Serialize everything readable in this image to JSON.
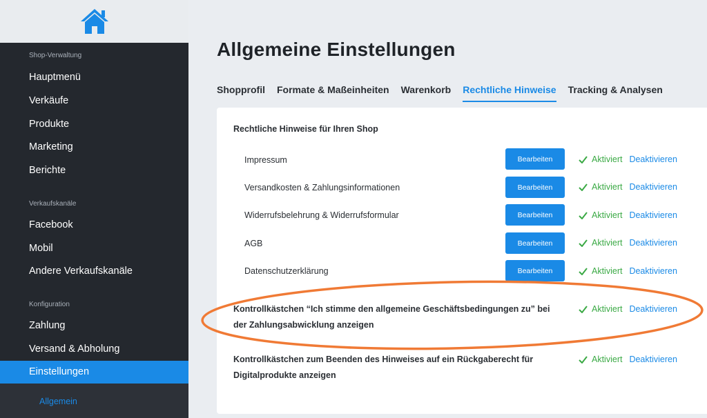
{
  "sidebar": {
    "sections": {
      "shop": "Shop-Verwaltung",
      "channels": "Verkaufskanäle",
      "config": "Konfiguration"
    },
    "items": [
      {
        "label": "Hauptmenü"
      },
      {
        "label": "Verkäufe"
      },
      {
        "label": "Produkte"
      },
      {
        "label": "Marketing"
      },
      {
        "label": "Berichte"
      },
      {
        "label": "Facebook"
      },
      {
        "label": "Mobil"
      },
      {
        "label": "Andere Verkaufskanäle"
      },
      {
        "label": "Zahlung"
      },
      {
        "label": "Versand & Abholung"
      },
      {
        "label": "Einstellungen"
      }
    ],
    "subitem": "Allgemein"
  },
  "page": {
    "title": "Allgemeine Einstellungen"
  },
  "tabs": [
    {
      "label": "Shopprofil"
    },
    {
      "label": "Formate & Maßeinheiten"
    },
    {
      "label": "Warenkorb"
    },
    {
      "label": "Rechtliche Hinweise"
    },
    {
      "label": "Tracking & Analysen"
    }
  ],
  "active_tab": "Rechtliche Hinweise",
  "card": {
    "heading": "Rechtliche Hinweise für Ihren Shop",
    "edit_label": "Bearbeiten",
    "status_active": "Aktiviert",
    "deactivate_label": "Deaktivieren",
    "rows": [
      {
        "label": "Impressum"
      },
      {
        "label": "Versandkosten & Zahlungsinformationen"
      },
      {
        "label": "Widerrufsbelehrung & Widerrufsformular"
      },
      {
        "label": "AGB"
      },
      {
        "label": "Datenschutzerklärung"
      }
    ],
    "checkbox_options": [
      {
        "label": "Kontrollkästchen “Ich stimme den allgemeine Geschäftsbedingungen zu” bei der Zahlungsabwicklung anzeigen"
      },
      {
        "label": "Kontrollkästchen zum Beenden des Hinweises auf ein Rückgaberecht für Digitalprodukte anzeigen"
      }
    ]
  },
  "colors": {
    "accent": "#1a8ae6",
    "sidebar_bg": "#24282e",
    "success": "#3aa944",
    "highlight": "#f07a35"
  },
  "icons": {
    "logo": "home-icon",
    "status": "check-icon"
  }
}
